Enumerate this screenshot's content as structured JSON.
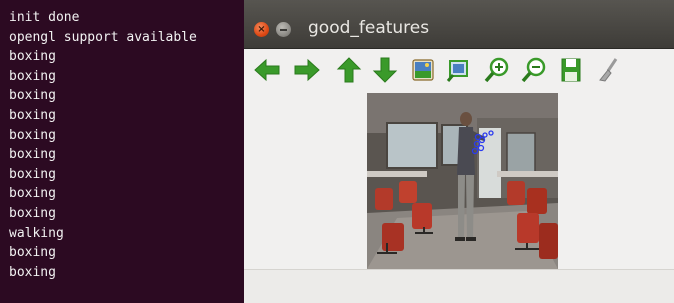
{
  "terminal": {
    "lines": [
      "init done",
      "opengl support available",
      "boxing",
      "boxing",
      "boxing",
      "boxing",
      "boxing",
      "boxing",
      "boxing",
      "boxing",
      "boxing",
      "walking",
      "boxing",
      "boxing"
    ],
    "background": "#2c0a22",
    "text_color": "#f2f2f2"
  },
  "window": {
    "title": "good_features",
    "controls": [
      "close-icon",
      "minimize-icon"
    ],
    "toolbar": [
      {
        "name": "arrow-left-icon",
        "color": "#3a9a2a"
      },
      {
        "name": "arrow-right-icon",
        "color": "#3a9a2a"
      },
      {
        "name": "arrow-up-icon",
        "color": "#3a9a2a"
      },
      {
        "name": "arrow-down-icon",
        "color": "#3a9a2a"
      },
      {
        "name": "image-icon",
        "color": "#4a7fc0"
      },
      {
        "name": "zoom-fit-icon",
        "color": "#4a7fc0"
      },
      {
        "name": "zoom-in-icon",
        "color": "#3a9a2a"
      },
      {
        "name": "zoom-out-icon",
        "color": "#3a9a2a"
      },
      {
        "name": "save-icon",
        "color": "#3a9a2a"
      },
      {
        "name": "properties-icon",
        "color": "#8a8a8a"
      }
    ],
    "status_text": ""
  }
}
